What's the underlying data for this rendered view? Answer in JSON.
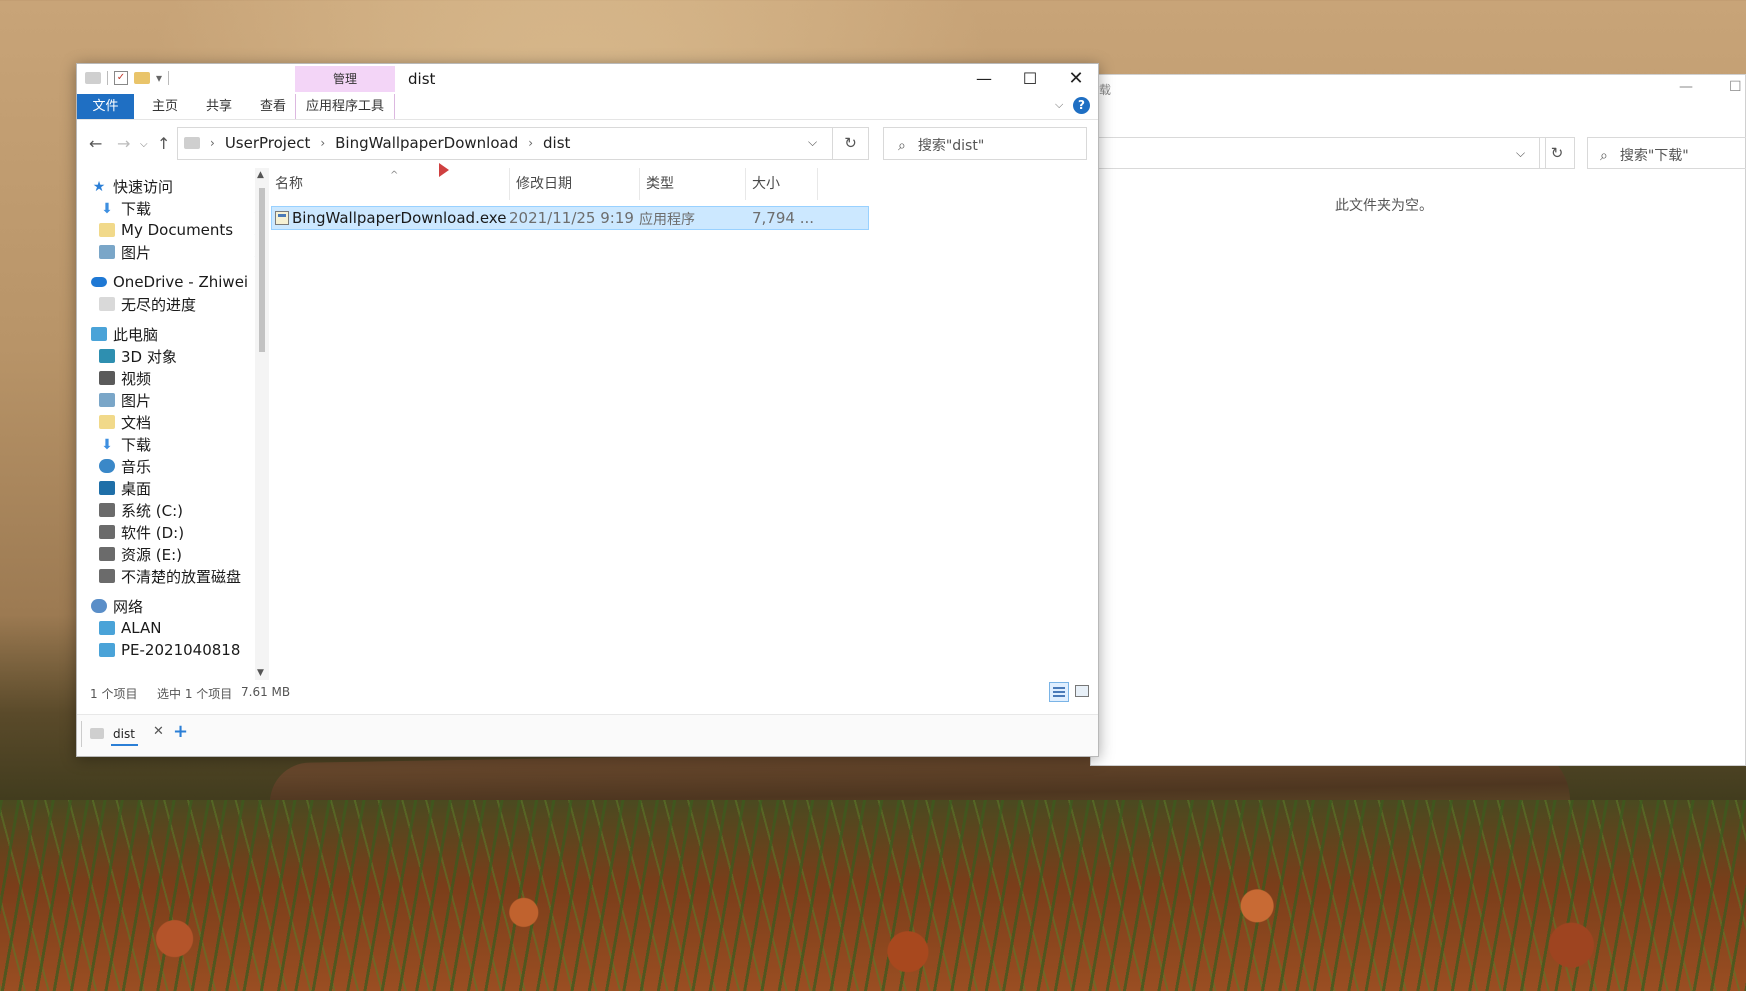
{
  "background_window": {
    "title": "载",
    "minimize_label": "—",
    "maximize_label": "☐",
    "refresh_label": "↻",
    "address_chevron": "⌵",
    "search_placeholder": "搜索\"下载\"",
    "search_icon": "⌕",
    "empty_message": "此文件夹为空。"
  },
  "window": {
    "title": "dist",
    "context_tab_label": "管理",
    "controls": {
      "minimize": "—",
      "maximize": "☐",
      "close": "✕"
    }
  },
  "quick_access_toolbar": {
    "customize_glyph": "▾"
  },
  "ribbon": {
    "tabs": {
      "file": "文件",
      "home": "主页",
      "share": "共享",
      "view": "查看",
      "app_tools": "应用程序工具"
    },
    "collapse_glyph": "⌵",
    "help_glyph": "?"
  },
  "navigation": {
    "back_glyph": "←",
    "forward_glyph": "→",
    "history_glyph": "⌵",
    "up_glyph": "↑",
    "breadcrumb": [
      "UserProject",
      "BingWallpaperDownload",
      "dist"
    ],
    "breadcrumb_sep": "›",
    "address_chevron": "⌵",
    "refresh_glyph": "↻",
    "search_placeholder": "搜索\"dist\"",
    "search_icon": "⌕"
  },
  "sidebar": {
    "quick_access": "快速访问",
    "qa_items": [
      "下载",
      "My Documents",
      "图片"
    ],
    "pin_glyph": "📌",
    "onedrive": "OneDrive - Zhiwei",
    "onedrive_items": [
      "无尽的进度"
    ],
    "this_pc": "此电脑",
    "pc_items": [
      "3D 对象",
      "视频",
      "图片",
      "文档",
      "下载",
      "音乐",
      "桌面",
      "系统 (C:)",
      "软件 (D:)",
      "资源 (E:)",
      "不清楚的放置磁盘"
    ],
    "network": "网络",
    "network_items": [
      "ALAN",
      "PE-2021040818"
    ],
    "scroll_up": "▲",
    "scroll_down": "▼"
  },
  "file_list": {
    "columns": {
      "name": "名称",
      "date": "修改日期",
      "type": "类型",
      "size": "大小"
    },
    "sort_glyph": "^",
    "rows": [
      {
        "name": "BingWallpaperDownload.exe",
        "date": "2021/11/25 9:19",
        "type": "应用程序",
        "size": "7,794 ..."
      }
    ]
  },
  "status": {
    "count": "1 个项目",
    "selected": "选中 1 个项目",
    "size": "7.61 MB"
  },
  "tabs": {
    "label": "dist",
    "close": "✕",
    "add": "+"
  },
  "colors": {
    "accent": "#1f6fc3",
    "selection": "#cce8ff",
    "context_tab": "#f3d5f7"
  }
}
